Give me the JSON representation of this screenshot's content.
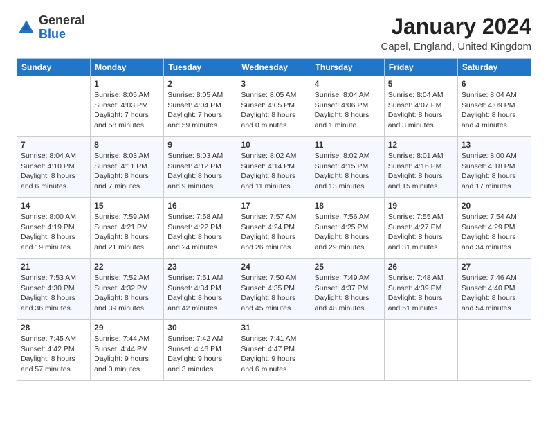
{
  "logo": {
    "general": "General",
    "blue": "Blue"
  },
  "title": "January 2024",
  "location": "Capel, England, United Kingdom",
  "days_of_week": [
    "Sunday",
    "Monday",
    "Tuesday",
    "Wednesday",
    "Thursday",
    "Friday",
    "Saturday"
  ],
  "weeks": [
    [
      {
        "day": "",
        "sunrise": "",
        "sunset": "",
        "daylight": ""
      },
      {
        "day": "1",
        "sunrise": "Sunrise: 8:05 AM",
        "sunset": "Sunset: 4:03 PM",
        "daylight": "Daylight: 7 hours and 58 minutes."
      },
      {
        "day": "2",
        "sunrise": "Sunrise: 8:05 AM",
        "sunset": "Sunset: 4:04 PM",
        "daylight": "Daylight: 7 hours and 59 minutes."
      },
      {
        "day": "3",
        "sunrise": "Sunrise: 8:05 AM",
        "sunset": "Sunset: 4:05 PM",
        "daylight": "Daylight: 8 hours and 0 minutes."
      },
      {
        "day": "4",
        "sunrise": "Sunrise: 8:04 AM",
        "sunset": "Sunset: 4:06 PM",
        "daylight": "Daylight: 8 hours and 1 minute."
      },
      {
        "day": "5",
        "sunrise": "Sunrise: 8:04 AM",
        "sunset": "Sunset: 4:07 PM",
        "daylight": "Daylight: 8 hours and 3 minutes."
      },
      {
        "day": "6",
        "sunrise": "Sunrise: 8:04 AM",
        "sunset": "Sunset: 4:09 PM",
        "daylight": "Daylight: 8 hours and 4 minutes."
      }
    ],
    [
      {
        "day": "7",
        "sunrise": "Sunrise: 8:04 AM",
        "sunset": "Sunset: 4:10 PM",
        "daylight": "Daylight: 8 hours and 6 minutes."
      },
      {
        "day": "8",
        "sunrise": "Sunrise: 8:03 AM",
        "sunset": "Sunset: 4:11 PM",
        "daylight": "Daylight: 8 hours and 7 minutes."
      },
      {
        "day": "9",
        "sunrise": "Sunrise: 8:03 AM",
        "sunset": "Sunset: 4:12 PM",
        "daylight": "Daylight: 8 hours and 9 minutes."
      },
      {
        "day": "10",
        "sunrise": "Sunrise: 8:02 AM",
        "sunset": "Sunset: 4:14 PM",
        "daylight": "Daylight: 8 hours and 11 minutes."
      },
      {
        "day": "11",
        "sunrise": "Sunrise: 8:02 AM",
        "sunset": "Sunset: 4:15 PM",
        "daylight": "Daylight: 8 hours and 13 minutes."
      },
      {
        "day": "12",
        "sunrise": "Sunrise: 8:01 AM",
        "sunset": "Sunset: 4:16 PM",
        "daylight": "Daylight: 8 hours and 15 minutes."
      },
      {
        "day": "13",
        "sunrise": "Sunrise: 8:00 AM",
        "sunset": "Sunset: 4:18 PM",
        "daylight": "Daylight: 8 hours and 17 minutes."
      }
    ],
    [
      {
        "day": "14",
        "sunrise": "Sunrise: 8:00 AM",
        "sunset": "Sunset: 4:19 PM",
        "daylight": "Daylight: 8 hours and 19 minutes."
      },
      {
        "day": "15",
        "sunrise": "Sunrise: 7:59 AM",
        "sunset": "Sunset: 4:21 PM",
        "daylight": "Daylight: 8 hours and 21 minutes."
      },
      {
        "day": "16",
        "sunrise": "Sunrise: 7:58 AM",
        "sunset": "Sunset: 4:22 PM",
        "daylight": "Daylight: 8 hours and 24 minutes."
      },
      {
        "day": "17",
        "sunrise": "Sunrise: 7:57 AM",
        "sunset": "Sunset: 4:24 PM",
        "daylight": "Daylight: 8 hours and 26 minutes."
      },
      {
        "day": "18",
        "sunrise": "Sunrise: 7:56 AM",
        "sunset": "Sunset: 4:25 PM",
        "daylight": "Daylight: 8 hours and 29 minutes."
      },
      {
        "day": "19",
        "sunrise": "Sunrise: 7:55 AM",
        "sunset": "Sunset: 4:27 PM",
        "daylight": "Daylight: 8 hours and 31 minutes."
      },
      {
        "day": "20",
        "sunrise": "Sunrise: 7:54 AM",
        "sunset": "Sunset: 4:29 PM",
        "daylight": "Daylight: 8 hours and 34 minutes."
      }
    ],
    [
      {
        "day": "21",
        "sunrise": "Sunrise: 7:53 AM",
        "sunset": "Sunset: 4:30 PM",
        "daylight": "Daylight: 8 hours and 36 minutes."
      },
      {
        "day": "22",
        "sunrise": "Sunrise: 7:52 AM",
        "sunset": "Sunset: 4:32 PM",
        "daylight": "Daylight: 8 hours and 39 minutes."
      },
      {
        "day": "23",
        "sunrise": "Sunrise: 7:51 AM",
        "sunset": "Sunset: 4:34 PM",
        "daylight": "Daylight: 8 hours and 42 minutes."
      },
      {
        "day": "24",
        "sunrise": "Sunrise: 7:50 AM",
        "sunset": "Sunset: 4:35 PM",
        "daylight": "Daylight: 8 hours and 45 minutes."
      },
      {
        "day": "25",
        "sunrise": "Sunrise: 7:49 AM",
        "sunset": "Sunset: 4:37 PM",
        "daylight": "Daylight: 8 hours and 48 minutes."
      },
      {
        "day": "26",
        "sunrise": "Sunrise: 7:48 AM",
        "sunset": "Sunset: 4:39 PM",
        "daylight": "Daylight: 8 hours and 51 minutes."
      },
      {
        "day": "27",
        "sunrise": "Sunrise: 7:46 AM",
        "sunset": "Sunset: 4:40 PM",
        "daylight": "Daylight: 8 hours and 54 minutes."
      }
    ],
    [
      {
        "day": "28",
        "sunrise": "Sunrise: 7:45 AM",
        "sunset": "Sunset: 4:42 PM",
        "daylight": "Daylight: 8 hours and 57 minutes."
      },
      {
        "day": "29",
        "sunrise": "Sunrise: 7:44 AM",
        "sunset": "Sunset: 4:44 PM",
        "daylight": "Daylight: 9 hours and 0 minutes."
      },
      {
        "day": "30",
        "sunrise": "Sunrise: 7:42 AM",
        "sunset": "Sunset: 4:46 PM",
        "daylight": "Daylight: 9 hours and 3 minutes."
      },
      {
        "day": "31",
        "sunrise": "Sunrise: 7:41 AM",
        "sunset": "Sunset: 4:47 PM",
        "daylight": "Daylight: 9 hours and 6 minutes."
      },
      {
        "day": "",
        "sunrise": "",
        "sunset": "",
        "daylight": ""
      },
      {
        "day": "",
        "sunrise": "",
        "sunset": "",
        "daylight": ""
      },
      {
        "day": "",
        "sunrise": "",
        "sunset": "",
        "daylight": ""
      }
    ]
  ]
}
